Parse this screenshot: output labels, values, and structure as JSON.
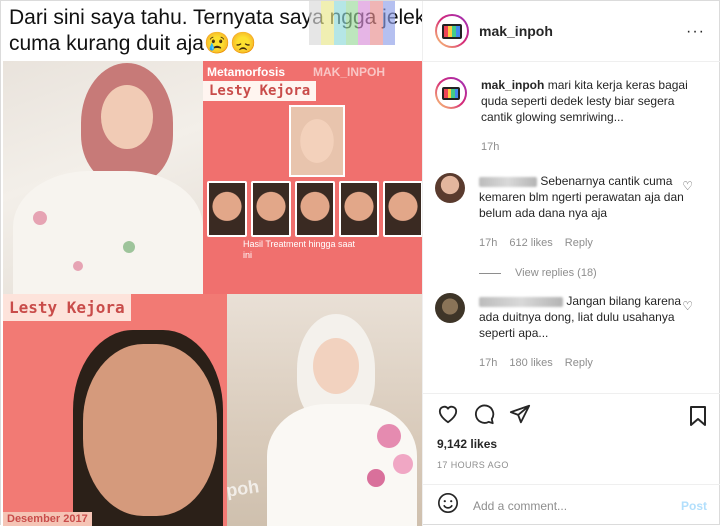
{
  "post": {
    "caption_line1": "Dari sini saya tahu. Ternyata saya ngga jelek,",
    "caption_line2": "cuma kurang duit aja😢😞",
    "card_title_small": "Metamorfosis",
    "card_watermark": "MAK_INPOH",
    "card_name": "Lesty Kejora",
    "card_bottom_name": "Lesty Kejora",
    "card_treatment": "Hasil Treatment hingga saat ini",
    "card_date": "Desember 2017",
    "watermark_bottom": "@mak_inpoh"
  },
  "account": {
    "username": "mak_inpoh",
    "more_label": "···"
  },
  "caption_comment": {
    "username": "mak_inpoh",
    "text": "mari kita kerja keras bagai quda seperti dedek lesty biar segera cantik glowing semriwing...",
    "time": "17h"
  },
  "comments": [
    {
      "text": "Sebenarnya cantik cuma kemaren blm ngerti perawatan aja dan belum ada dana nya aja",
      "time": "17h",
      "likes": "612 likes",
      "reply": "Reply"
    },
    {
      "text": "Jangan bilang karena ada duitnya dong, liat dulu usahanya seperti apa...",
      "time": "17h",
      "likes": "180 likes",
      "reply": "Reply"
    }
  ],
  "view_replies": "View replies (18)",
  "likes_count": "9,142 likes",
  "time_ago": "17 HOURS AGO",
  "add_comment_placeholder": "Add a comment...",
  "post_button": "Post",
  "colors": {
    "post_blue_disabled": "#b2dffc",
    "meta_gray": "#8e8e8e",
    "pink_card": "#f0706e"
  }
}
